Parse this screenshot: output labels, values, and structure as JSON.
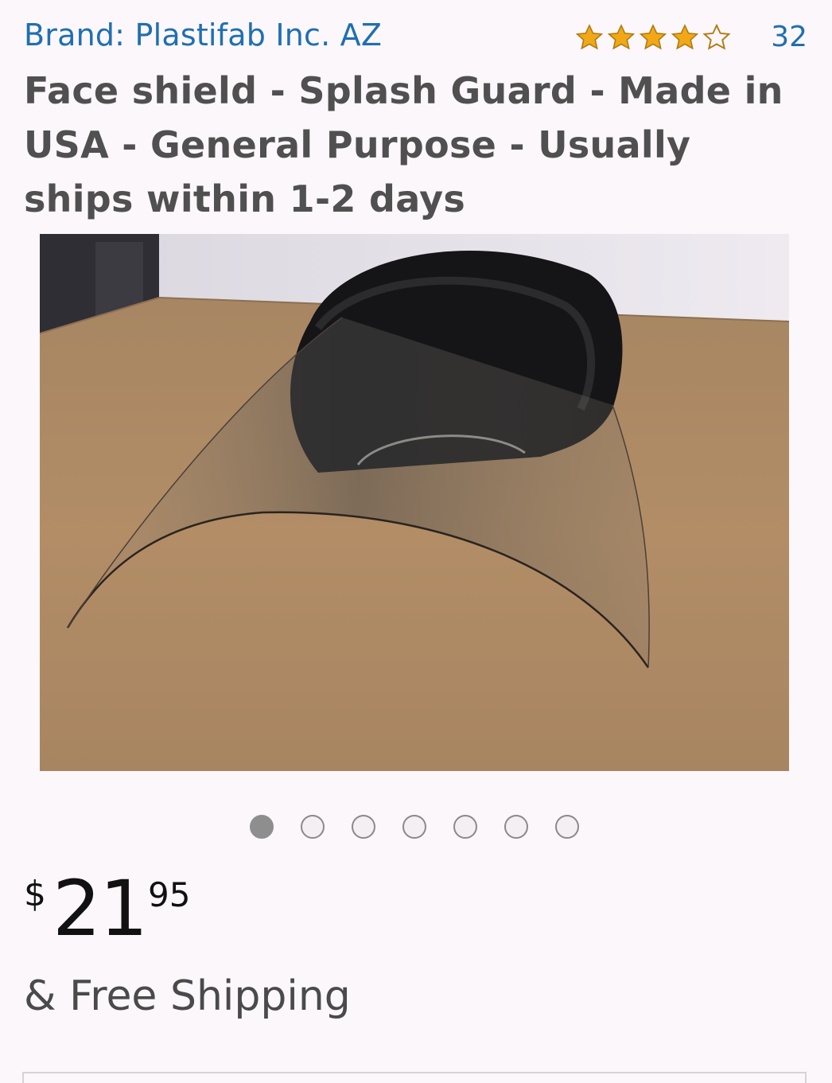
{
  "brand": {
    "text": "Brand: Plastifab Inc. AZ"
  },
  "rating": {
    "stars": 4,
    "max_stars": 5,
    "count": "32",
    "star_color": "#f0a818"
  },
  "title": {
    "text": "Face shield - Splash Guard - Made in USA - General Purpose - Usually ships within 1-2 days"
  },
  "carousel": {
    "total": 7,
    "active_index": 0
  },
  "price": {
    "currency": "$",
    "whole": "21",
    "fraction": "95"
  },
  "shipping": {
    "text": "& Free Shipping"
  },
  "colors": {
    "link": "#1f6fb2",
    "background": "#fcf7fa"
  }
}
